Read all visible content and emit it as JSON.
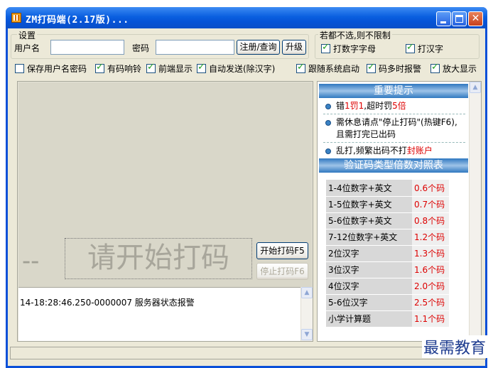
{
  "window": {
    "title": "ZM打码端(2.17版)...",
    "controls": {
      "minimize": "",
      "maximize": "",
      "close": "✕"
    }
  },
  "settings": {
    "legend": "设置",
    "username_label": "用户名",
    "username_value": "",
    "password_label": "密码",
    "password_value": "",
    "register_button": "注册/查询",
    "upgrade_button": "升级"
  },
  "filter": {
    "legend": "若都不选,则不限制",
    "digits_letters": {
      "label": "打数字字母",
      "checked": true
    },
    "chinese": {
      "label": "打汉字",
      "checked": true
    }
  },
  "options": [
    {
      "label": "保存用户名密码",
      "checked": false
    },
    {
      "label": "有码响铃",
      "checked": true
    },
    {
      "label": "前端显示",
      "checked": true
    },
    {
      "label": "自动发送(除汉字)",
      "checked": true
    },
    {
      "label": "跟随系统启动",
      "checked": true
    },
    {
      "label": "码多时报警",
      "checked": true
    },
    {
      "label": "放大显示",
      "checked": true
    }
  ],
  "main": {
    "dash": "--",
    "prompt": "请开始打码",
    "start_button": "开始打码F5",
    "stop_button": "停止打码F6"
  },
  "log": {
    "entry": "14-18:28:46.250-0000007 服务器状态报警"
  },
  "notice": {
    "title": "重要提示",
    "tip1": {
      "a": "错",
      "b": "1罚1",
      "c": ",超时罚",
      "d": "5倍"
    },
    "tip2": "需休息请点\"停止打码\"(热键F6),且需打完已出码",
    "tip3": {
      "a": "乱打,频繁出码不打",
      "b": "封账户"
    }
  },
  "multiplier_table": {
    "title": "验证码类型倍数对照表",
    "rows": [
      {
        "type": "1-4位数字+英文",
        "value": "0.6个码"
      },
      {
        "type": "1-5位数字+英文",
        "value": "0.7个码"
      },
      {
        "type": "5-6位数字+英文",
        "value": "0.8个码"
      },
      {
        "type": "7-12位数字+英文",
        "value": "1.2个码"
      },
      {
        "type": "2位汉字",
        "value": "1.3个码"
      },
      {
        "type": "3位汉字",
        "value": "1.6个码"
      },
      {
        "type": "4位汉字",
        "value": "2.0个码"
      },
      {
        "type": "5-6位汉字",
        "value": "2.5个码"
      },
      {
        "type": "小学计算题",
        "value": "1.1个码"
      }
    ]
  },
  "watermark": "最需教育",
  "colors": {
    "title_bar": "#0a5fe0",
    "accent_red": "#dd0000",
    "banner_blue": "#2f78c0"
  }
}
